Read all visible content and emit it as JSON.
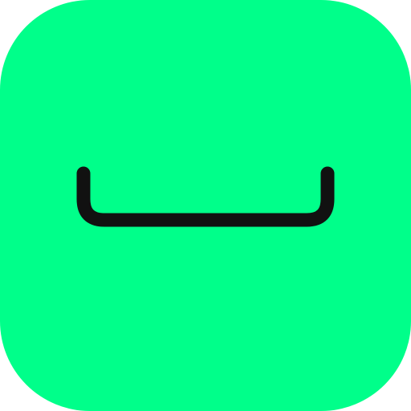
{
  "app_icon": {
    "glyph": "space-bar-icon",
    "colors": {
      "background": "#00FF8A",
      "glyph": "#111111"
    }
  }
}
